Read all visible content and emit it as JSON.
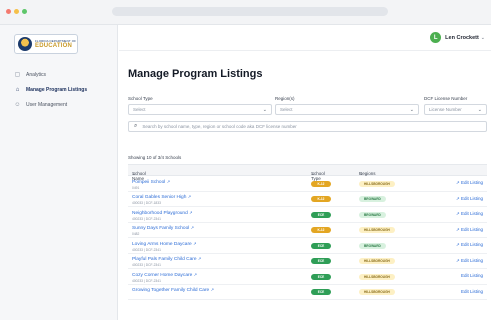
{
  "theme": {
    "accent": "#2c6cd6",
    "public_badge": "#e3a623",
    "ece_badge": "#2f9e57",
    "region_hillsborough_bg": "#fdf0c4",
    "region_hillsborough_fg": "#8a6d1a",
    "region_broward_bg": "#d8f1df",
    "region_broward_fg": "#2a7a45",
    "avatar_bg": "#4caf50"
  },
  "logo": {
    "top_text": "FLORIDA DEPARTMENT OF",
    "main_text": "EDUCATION"
  },
  "sidebar": {
    "items": [
      {
        "label": "Analytics",
        "icon": "chart-icon",
        "glyph": "▢",
        "active": false
      },
      {
        "label": "Manage Program Listings",
        "icon": "school-icon",
        "glyph": "⌂",
        "active": true
      },
      {
        "label": "User Management",
        "icon": "users-icon",
        "glyph": "☺",
        "active": false
      }
    ]
  },
  "header": {
    "user_name": "Len Crockett",
    "user_initial": "L"
  },
  "page": {
    "title": "Manage Program Listings"
  },
  "filters": {
    "school_type": {
      "label": "School Type",
      "placeholder": "Select"
    },
    "regions": {
      "label": "Region(s)",
      "placeholder": "Select"
    },
    "license": {
      "label": "DCF License Number",
      "placeholder": "License Number"
    },
    "search_placeholder": "Search by school name, type, region or school code aka DCF license number"
  },
  "table": {
    "showing": "Showing 10 of 3/4 Schools",
    "columns": {
      "name": "School Name",
      "type": "School Type",
      "regions": "Regions",
      "sort": "⌄"
    },
    "rows": [
      {
        "name": "Pompeii School",
        "sub": "0491",
        "type": "K-12",
        "type_kind": "public",
        "region": "HILLSBOROUGH",
        "region_kind": "hillsborough",
        "edit": "Edit Listing",
        "edit_icon": true
      },
      {
        "name": "Coral Gables Senior High",
        "sub": "400033 | DCF-1833",
        "type": "K-12",
        "type_kind": "public",
        "region": "BROWARD",
        "region_kind": "broward",
        "edit": "Edit Listing",
        "edit_icon": true
      },
      {
        "name": "Neighborhood Playground",
        "sub": "400233 | DCF-2341",
        "type": "ECE",
        "type_kind": "ece",
        "region": "BROWARD",
        "region_kind": "broward",
        "edit": "Edit Listing",
        "edit_icon": true
      },
      {
        "name": "Sunny Days Family School",
        "sub": "0482",
        "type": "K-12",
        "type_kind": "public",
        "region": "HILLSBOROUGH",
        "region_kind": "hillsborough",
        "edit": "Edit Listing",
        "edit_icon": true
      },
      {
        "name": "Loving Arms Home Daycare",
        "sub": "400233 | DCF-2341",
        "type": "ECE",
        "type_kind": "ece",
        "region": "BROWARD",
        "region_kind": "broward",
        "edit": "Edit Listing",
        "edit_icon": true
      },
      {
        "name": "Playful Pals Family Child Care",
        "sub": "400233 | DCF-2341",
        "type": "ECE",
        "type_kind": "ece",
        "region": "HILLSBOROUGH",
        "region_kind": "hillsborough",
        "edit": "Edit Listing",
        "edit_icon": true
      },
      {
        "name": "Cozy Corner Home Daycare",
        "sub": "400233 | DCF-2341",
        "type": "ECE",
        "type_kind": "ece",
        "region": "HILLSBOROUGH",
        "region_kind": "hillsborough",
        "edit": "Edit Listing",
        "edit_icon": false
      },
      {
        "name": "Growing Together Family Child Care",
        "sub": "",
        "type": "ECE",
        "type_kind": "ece",
        "region": "HILLSBOROUGH",
        "region_kind": "hillsborough",
        "edit": "Edit Listing",
        "edit_icon": false
      }
    ]
  }
}
